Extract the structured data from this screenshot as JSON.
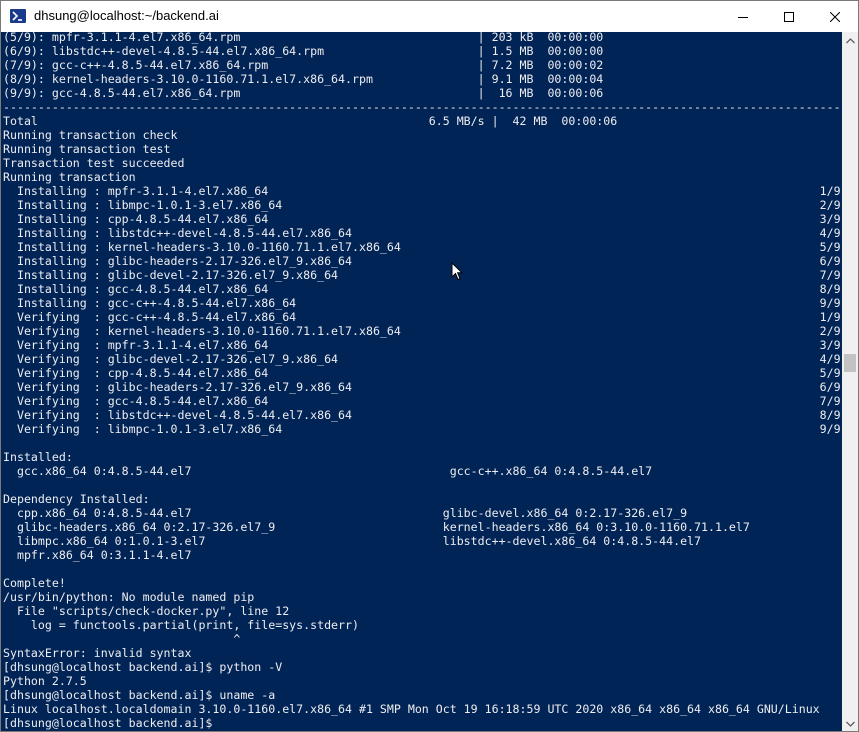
{
  "window": {
    "title": "dhsung@localhost:~/backend.ai"
  },
  "icons": {
    "app": "powershell-terminal-icon",
    "minimize": "minimize-icon",
    "maximize": "maximize-icon",
    "close": "close-icon",
    "scroll_up": "chevron-up-icon",
    "scroll_down": "chevron-down-icon",
    "pointer": "mouse-pointer-icon"
  },
  "colors": {
    "terminal_bg": "#012456",
    "terminal_fg": "#eeedf0"
  },
  "terminal": {
    "lines": [
      "(5/9): mpfr-3.1.1-4.el7.x86_64.rpm                                  | 203 kB  00:00:00",
      "(6/9): libstdc++-devel-4.8.5-44.el7.x86_64.rpm                      | 1.5 MB  00:00:00",
      "(7/9): gcc-c++-4.8.5-44.el7.x86_64.rpm                              | 7.2 MB  00:00:02",
      "(8/9): kernel-headers-3.10.0-1160.71.1.el7.x86_64.rpm               | 9.1 MB  00:00:04",
      "(9/9): gcc-4.8.5-44.el7.x86_64.rpm                                  |  16 MB  00:00:06",
      "------------------------------------------------------------------------------------------------------------------------",
      "Total                                                        6.5 MB/s |  42 MB  00:00:06",
      "Running transaction check",
      "Running transaction test",
      "Transaction test succeeded",
      "Running transaction",
      "  Installing : mpfr-3.1.1-4.el7.x86_64                                                                               1/9",
      "  Installing : libmpc-1.0.1-3.el7.x86_64                                                                             2/9",
      "  Installing : cpp-4.8.5-44.el7.x86_64                                                                               3/9",
      "  Installing : libstdc++-devel-4.8.5-44.el7.x86_64                                                                   4/9",
      "  Installing : kernel-headers-3.10.0-1160.71.1.el7.x86_64                                                            5/9",
      "  Installing : glibc-headers-2.17-326.el7_9.x86_64                                                                   6/9",
      "  Installing : glibc-devel-2.17-326.el7_9.x86_64                                                                     7/9",
      "  Installing : gcc-4.8.5-44.el7.x86_64                                                                               8/9",
      "  Installing : gcc-c++-4.8.5-44.el7.x86_64                                                                           9/9",
      "  Verifying  : gcc-c++-4.8.5-44.el7.x86_64                                                                           1/9",
      "  Verifying  : kernel-headers-3.10.0-1160.71.1.el7.x86_64                                                            2/9",
      "  Verifying  : mpfr-3.1.1-4.el7.x86_64                                                                               3/9",
      "  Verifying  : glibc-devel-2.17-326.el7_9.x86_64                                                                     4/9",
      "  Verifying  : cpp-4.8.5-44.el7.x86_64                                                                               5/9",
      "  Verifying  : glibc-headers-2.17-326.el7_9.x86_64                                                                   6/9",
      "  Verifying  : gcc-4.8.5-44.el7.x86_64                                                                               7/9",
      "  Verifying  : libstdc++-devel-4.8.5-44.el7.x86_64                                                                   8/9",
      "  Verifying  : libmpc-1.0.1-3.el7.x86_64                                                                             9/9",
      "",
      "Installed:",
      "  gcc.x86_64 0:4.8.5-44.el7                                     gcc-c++.x86_64 0:4.8.5-44.el7",
      "",
      "Dependency Installed:",
      "  cpp.x86_64 0:4.8.5-44.el7                                    glibc-devel.x86_64 0:2.17-326.el7_9",
      "  glibc-headers.x86_64 0:2.17-326.el7_9                        kernel-headers.x86_64 0:3.10.0-1160.71.1.el7",
      "  libmpc.x86_64 0:1.0.1-3.el7                                  libstdc++-devel.x86_64 0:4.8.5-44.el7",
      "  mpfr.x86_64 0:3.1.1-4.el7",
      "",
      "Complete!",
      "/usr/bin/python: No module named pip",
      "  File \"scripts/check-docker.py\", line 12",
      "    log = functools.partial(print, file=sys.stderr)",
      "                                 ^",
      "SyntaxError: invalid syntax",
      "[dhsung@localhost backend.ai]$ python -V",
      "Python 2.7.5",
      "[dhsung@localhost backend.ai]$ uname -a",
      "Linux localhost.localdomain 3.10.0-1160.el7.x86_64 #1 SMP Mon Oct 19 16:18:59 UTC 2020 x86_64 x86_64 x86_64 GNU/Linux",
      "[dhsung@localhost backend.ai]$ "
    ]
  }
}
